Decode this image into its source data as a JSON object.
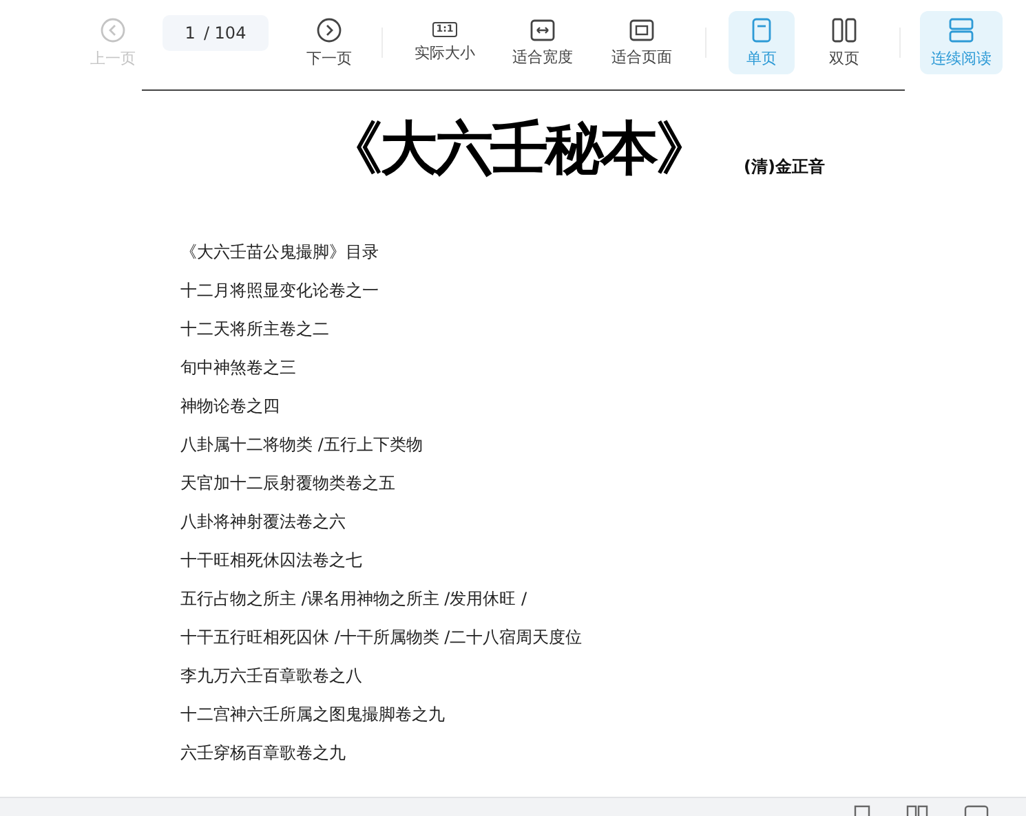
{
  "toolbar": {
    "items": [
      {
        "kind": "prev",
        "label": "上一页",
        "disabled": true
      },
      {
        "kind": "pager",
        "current": "1",
        "total": "/ 104"
      },
      {
        "kind": "next",
        "label": "下一页",
        "disabled": false
      },
      {
        "kind": "divider"
      },
      {
        "kind": "actual",
        "label": "实际大小",
        "icon_text": "1:1"
      },
      {
        "kind": "fitwidth",
        "label": "适合宽度"
      },
      {
        "kind": "fitpage",
        "label": "适合页面"
      },
      {
        "kind": "divider"
      },
      {
        "kind": "single",
        "label": "单页",
        "selected": true
      },
      {
        "kind": "double",
        "label": "双页",
        "selected": false
      },
      {
        "kind": "divider"
      },
      {
        "kind": "continuous",
        "label": "连续阅读",
        "selected": true
      }
    ]
  },
  "document": {
    "title": "《大六壬秘本》",
    "author": "(清)金正音",
    "lines": [
      "《大六壬苗公鬼撮脚》目录",
      "十二月将照显变化论卷之一",
      "十二天将所主卷之二",
      "旬中神煞卷之三",
      "神物论卷之四",
      "八卦属十二将物类 /五行上下类物",
      "天官加十二辰射覆物类卷之五",
      "八卦将神射覆法卷之六",
      "十干旺相死休囚法卷之七",
      "五行占物之所主 /课名用神物之所主 /发用休旺 /",
      "十干五行旺相死囚休 /十干所属物类 /二十八宿周天度位",
      "李九万六壬百章歌卷之八",
      "十二宫神六壬所属之图鬼撮脚卷之九",
      "六壬穿杨百章歌卷之九"
    ]
  }
}
